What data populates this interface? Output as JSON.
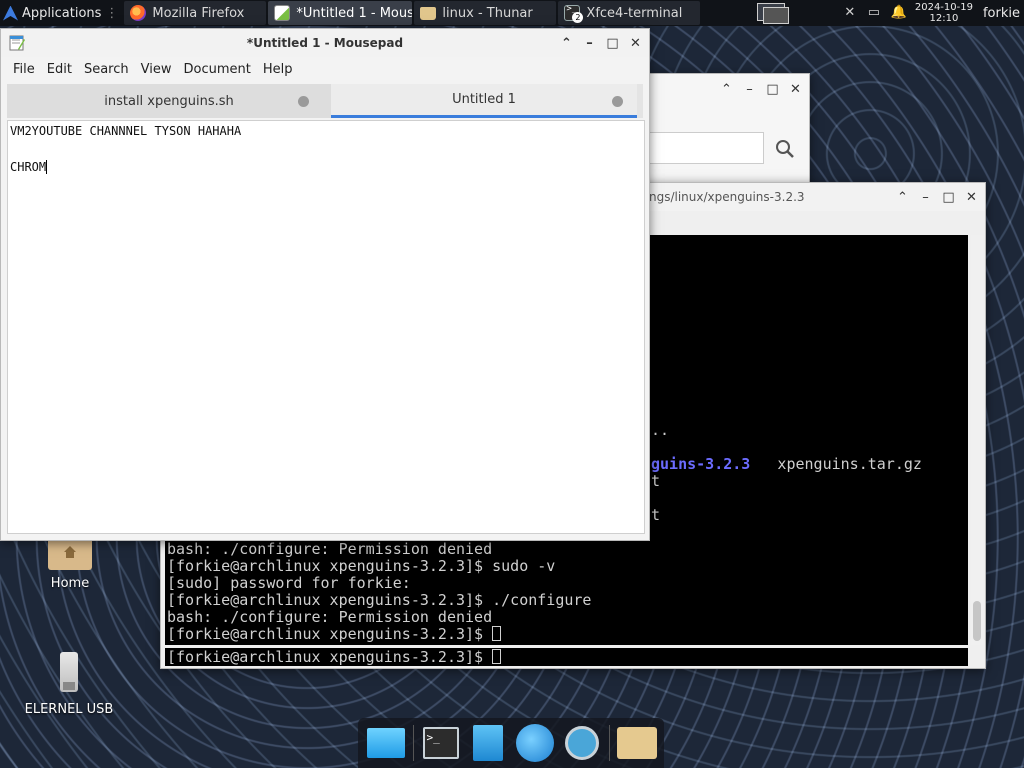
{
  "panel": {
    "applications_label": "Applications",
    "tasks": [
      {
        "label": "Mozilla Firefox",
        "icon": "firefox-icon"
      },
      {
        "label": "*Untitled 1 - Mous...",
        "icon": "mousepad-icon"
      },
      {
        "label": "linux - Thunar",
        "icon": "folder-icon"
      },
      {
        "label": "Xfce4-terminal",
        "icon": "terminal-icon"
      }
    ],
    "terminal_badge": "2",
    "clock_date": "2024-10-19",
    "clock_time": "12:10",
    "user": "forkie"
  },
  "mousepad": {
    "title": "*Untitled 1 - Mousepad",
    "menu": [
      "File",
      "Edit",
      "Search",
      "View",
      "Document",
      "Help"
    ],
    "tabs": [
      {
        "label": "install xpenguins.sh",
        "active": false
      },
      {
        "label": "Untitled 1",
        "active": true
      }
    ],
    "lines": [
      "VM2YOUTUBE CHANNNEL TYSON HAHAHA",
      "",
      "CHROM"
    ]
  },
  "terminal": {
    "title_partial": "ngs/linux/xpenguins-3.2.3",
    "partial_lines": [
      {
        "text": "..",
        "row": 11
      },
      {
        "text": "guins-3.2.3",
        "bold_blue": true,
        "row": 13,
        "after": "   xpenguins.tar.gz"
      },
      {
        "text": "t",
        "row": 14
      },
      {
        "text": "t",
        "row": 16
      }
    ],
    "lines": [
      "bash: ./configure: Permission denied",
      "[forkie@archlinux xpenguins-3.2.3]$ sudo -v",
      "[sudo] password for forkie:",
      "[forkie@archlinux xpenguins-3.2.3]$ ./configure",
      "bash: ./configure: Permission denied",
      "[forkie@archlinux xpenguins-3.2.3]$ "
    ],
    "bottom_prompt": "[forkie@archlinux xpenguins-3.2.3]$ "
  },
  "desktop": {
    "home_label": "Home",
    "usb_label": "ELERNEL USB"
  },
  "colors": {
    "accent_tab": "#3a7ddc",
    "terminal_bg": "#000000",
    "dir_blue": "#6c6cff"
  }
}
